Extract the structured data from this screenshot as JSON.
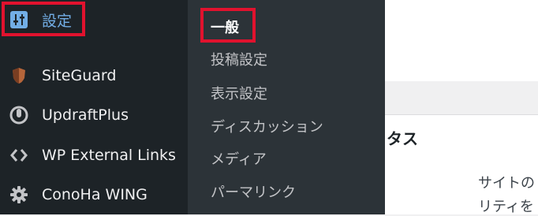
{
  "sidebar": {
    "items": [
      {
        "label": "設定",
        "icon": "settings-sliders-icon",
        "active": true
      },
      {
        "label": "SiteGuard",
        "icon": "siteguard-shield-icon"
      },
      {
        "label": "UpdraftPlus",
        "icon": "updraftplus-icon"
      },
      {
        "label": "WP External Links",
        "icon": "external-links-icon"
      },
      {
        "label": "ConoHa WING",
        "icon": "gear-icon"
      }
    ]
  },
  "submenu": {
    "items": [
      {
        "label": "一般",
        "current": true
      },
      {
        "label": "投稿設定"
      },
      {
        "label": "表示設定"
      },
      {
        "label": "ディスカッション"
      },
      {
        "label": "メディア"
      },
      {
        "label": "パーマリンク"
      }
    ]
  },
  "content": {
    "heading_fragment": "タス",
    "text_line_1": "サイトの",
    "text_line_2": "リティを"
  },
  "colors": {
    "sidebar_bg": "#1d2327",
    "submenu_bg": "#2c3338",
    "active_text": "#72aee6",
    "highlight": "#e1122e"
  }
}
